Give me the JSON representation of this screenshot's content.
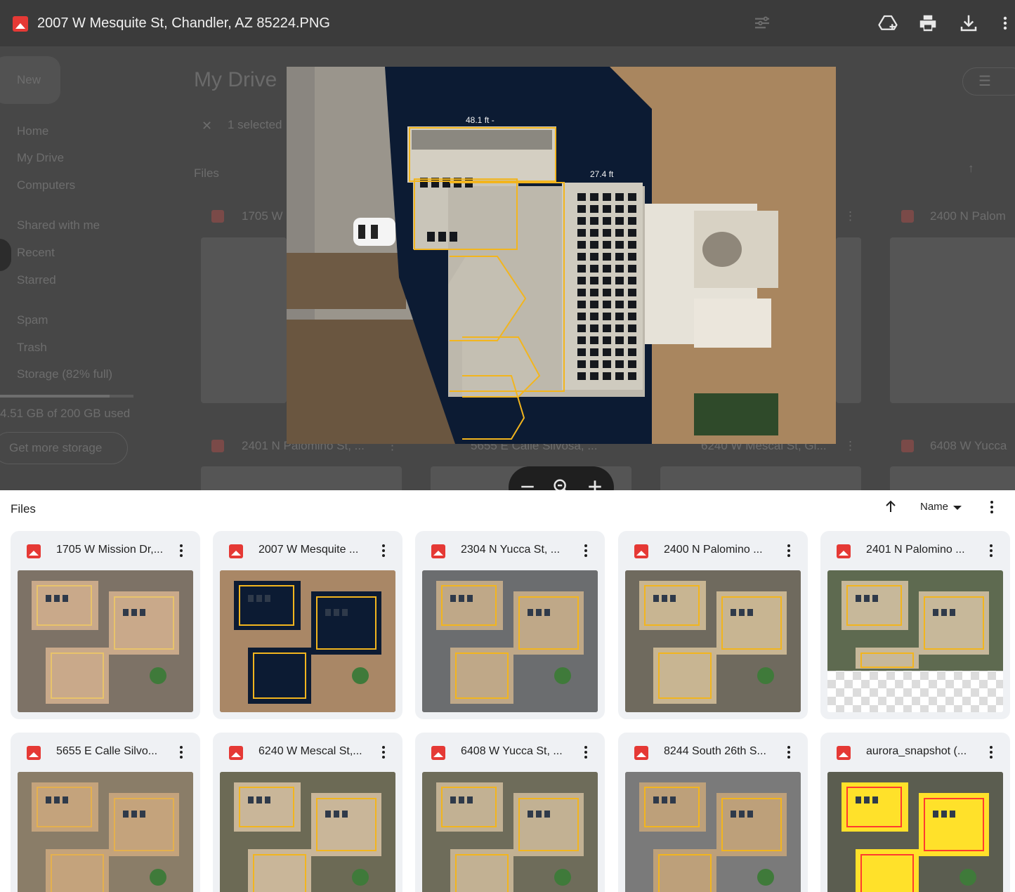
{
  "viewer": {
    "file_name": "2007 W Mesquite St, Chandler, AZ 85224.PNG",
    "toolbar_icons": [
      "add-to-drive-icon",
      "print-icon",
      "download-icon",
      "more-vert-icon"
    ]
  },
  "background_drive": {
    "new_button": "New",
    "page_title": "My Drive",
    "selection_label": "1 selected",
    "files_label": "Files",
    "nav": [
      "Home",
      "My Drive",
      "Computers",
      "Shared with me",
      "Recent",
      "Starred",
      "Spam",
      "Trash",
      "Storage (82% full)"
    ],
    "storage_text": "4.51 GB of 200 GB used",
    "storage_fraction": 0.82,
    "get_more_storage": "Get more storage",
    "card_titles": [
      "1705 W",
      "2400 N Palom",
      "2401 N Palomino St, ...",
      "5655 E Calle Silvosa, ...",
      "6240 W Mescal St, Gl...",
      "6408 W Yucca"
    ]
  },
  "image_annotations": {
    "dim_top": "48.1 ft -",
    "dim_right": "27.4 ft"
  },
  "files": {
    "header": "Files",
    "sort_label": "Name",
    "cards": [
      {
        "name": "1705 W Mission Dr,..."
      },
      {
        "name": "2007 W Mesquite ..."
      },
      {
        "name": "2304 N Yucca St, ..."
      },
      {
        "name": "2400 N Palomino ..."
      },
      {
        "name": "2401 N Palomino ..."
      },
      {
        "name": "5655 E Calle Silvo..."
      },
      {
        "name": "6240 W Mescal St,..."
      },
      {
        "name": "6408 W Yucca St, ..."
      },
      {
        "name": "8244 South 26th S..."
      },
      {
        "name": "aurora_snapshot (..."
      }
    ]
  },
  "colors": {
    "overlay": "#474747",
    "toolbar": "#3b3b3b",
    "card_bg": "#eff1f4",
    "image_icon": "#e53935",
    "roof_outline": "#f2b51e"
  }
}
